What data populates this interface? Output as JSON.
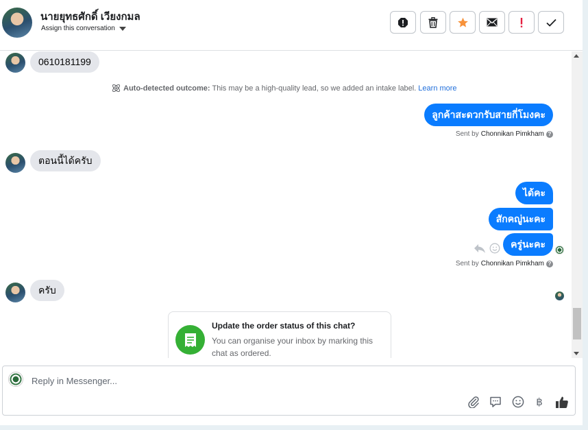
{
  "header": {
    "contact_name": "นายยุทธศักดิ์ เวียงกมล",
    "assign_label": "Assign this conversation",
    "actions": [
      {
        "name": "mark-spam",
        "icon": "alert-octagon-icon"
      },
      {
        "name": "delete",
        "icon": "trash-icon"
      },
      {
        "name": "star",
        "icon": "star-icon",
        "color": "#f7923b"
      },
      {
        "name": "mark-unread",
        "icon": "envelope-icon"
      },
      {
        "name": "mark-important",
        "icon": "exclamation-icon",
        "color": "#e41e3f"
      },
      {
        "name": "mark-done",
        "icon": "check-icon"
      }
    ]
  },
  "messages": {
    "incoming_1": "0610181199",
    "outcome": {
      "label": "Auto-detected outcome:",
      "text": "This may be a high-quality lead, so we added an intake label.",
      "link": "Learn more"
    },
    "outgoing_1": "ลูกค้าสะดวกรับสายกี่โมงคะ",
    "sent_by_1": {
      "prefix": "Sent by",
      "name": "Chonnikan Pimkham"
    },
    "incoming_2": "ตอนนี้ได้ครับ",
    "outgoing_2a": "ได้คะ",
    "outgoing_2b": "สักคญู่นะคะ",
    "outgoing_2c": "ครู่นะคะ",
    "sent_by_2": {
      "prefix": "Sent by",
      "name": "Chonnikan Pimkham"
    },
    "incoming_3": "ครับ"
  },
  "order_card": {
    "title": "Update the order status of this chat?",
    "body": "You can organise your inbox by marking this chat as ordered."
  },
  "composer": {
    "placeholder": "Reply in Messenger...",
    "tools": [
      "paperclip-icon",
      "speech-bubble-icon",
      "smiley-icon",
      "baht-icon",
      "thumbs-up-icon"
    ],
    "baht_symbol": "฿"
  },
  "colors": {
    "outgoing_bubble": "#0a7cff",
    "incoming_bubble": "#e4e6eb",
    "link": "#216fdb",
    "card_icon": "#35b035"
  }
}
